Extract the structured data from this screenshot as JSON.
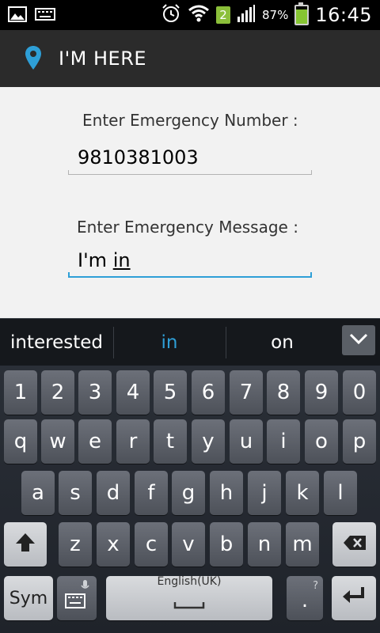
{
  "status_bar": {
    "battery_percent": "87%",
    "notification_count": "2",
    "time": "16:45",
    "icons": [
      "image-icon",
      "keyboard-icon",
      "alarm-icon",
      "wifi-icon",
      "signal-icon",
      "battery-icon"
    ]
  },
  "app_bar": {
    "title": "I'M HERE",
    "icon": "location-pin-icon",
    "accent": "#2e9fd7"
  },
  "form": {
    "number_label": "Enter Emergency Number :",
    "number_value": "9810381003",
    "message_label": "Enter Emergency Message :",
    "message_value_prefix": "I'm ",
    "message_value_composing": "in"
  },
  "suggestions": [
    "interested",
    "in",
    "on"
  ],
  "keyboard": {
    "row_numbers": [
      "1",
      "2",
      "3",
      "4",
      "5",
      "6",
      "7",
      "8",
      "9",
      "0"
    ],
    "row_qwerty": [
      "q",
      "w",
      "e",
      "r",
      "t",
      "y",
      "u",
      "i",
      "o",
      "p"
    ],
    "row_asdf": [
      "a",
      "s",
      "d",
      "f",
      "g",
      "h",
      "j",
      "k",
      "l"
    ],
    "row_zxcv": [
      "z",
      "x",
      "c",
      "v",
      "b",
      "n",
      "m"
    ],
    "sym_label": "Sym",
    "space_label": "English(UK)",
    "period_label": ".",
    "period_hint": "?"
  }
}
